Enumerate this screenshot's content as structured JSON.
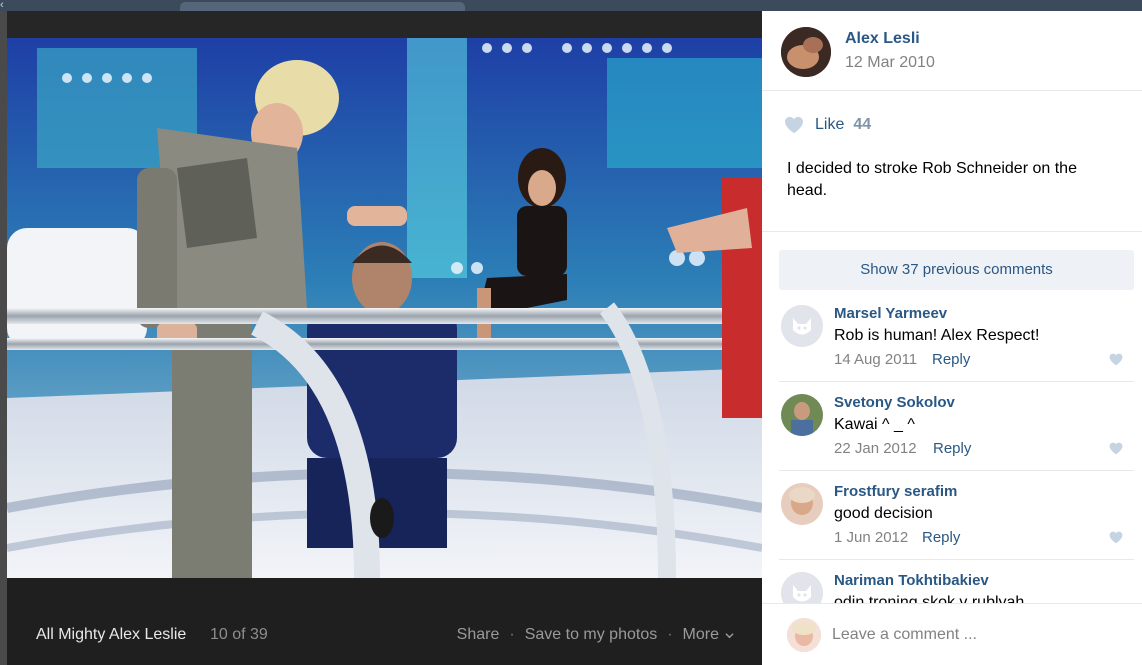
{
  "viewer": {
    "album_title": "All Mighty Alex Leslie",
    "counter": "10 of 39",
    "actions": [
      {
        "label": "Share"
      },
      {
        "label": "Save to my photos"
      },
      {
        "label": "More"
      }
    ],
    "separator": "·"
  },
  "post": {
    "author": "Alex Lesli",
    "date": "12 Mar 2010",
    "like_label": "Like",
    "like_count": "44",
    "description": "I decided to stroke Rob Schneider on the head."
  },
  "comments_section": {
    "show_previous": "Show 37 previous comments",
    "reply_label": "Reply",
    "items": [
      {
        "name": "Marsel Yarmeev",
        "text": "Rob is human! Alex Respect!",
        "date": "14 Aug 2011",
        "avatar": "default-avatar"
      },
      {
        "name": "Svetony Sokolov",
        "text": "Kawai ^ _ ^",
        "date": "22 Jan 2012",
        "avatar": "photo-avatar"
      },
      {
        "name": "Frostfury serafim",
        "text": "good decision",
        "date": "1 Jun 2012",
        "avatar": "photo-avatar"
      },
      {
        "name": "Nariman Tokhtibakiev",
        "text": "odin troning skok v rublyah",
        "date": "",
        "avatar": "default-avatar"
      }
    ]
  },
  "composer": {
    "placeholder": "Leave a comment ..."
  },
  "colors": {
    "link": "#2a5885",
    "muted": "#828282",
    "heart": "#c5d3e3"
  }
}
